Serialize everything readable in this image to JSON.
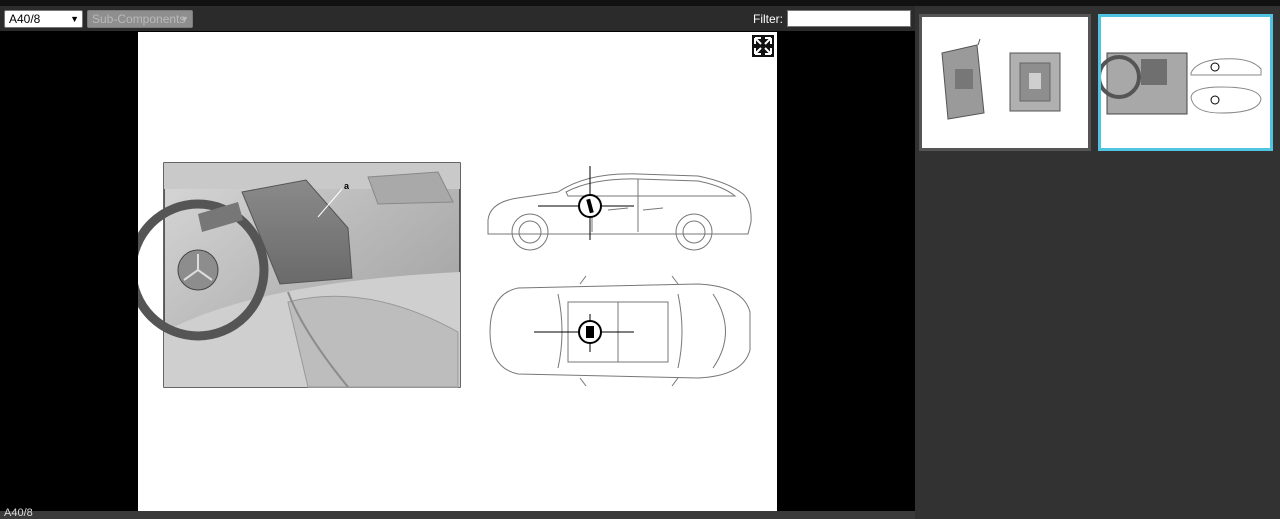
{
  "toolbar": {
    "component_select": "A40/8",
    "subcomponents_select": "Sub-Components",
    "filter_label": "Filter:",
    "filter_value": ""
  },
  "viewer": {
    "callout_label": "a",
    "expand_icon": "expand-icon"
  },
  "status": {
    "text": "A40/8"
  },
  "thumbnails": [
    {
      "name": "thumbnail-1",
      "selected": false
    },
    {
      "name": "thumbnail-2",
      "selected": true
    }
  ],
  "colors": {
    "selected_border": "#4fc3e0",
    "unselected_border": "#555555"
  }
}
